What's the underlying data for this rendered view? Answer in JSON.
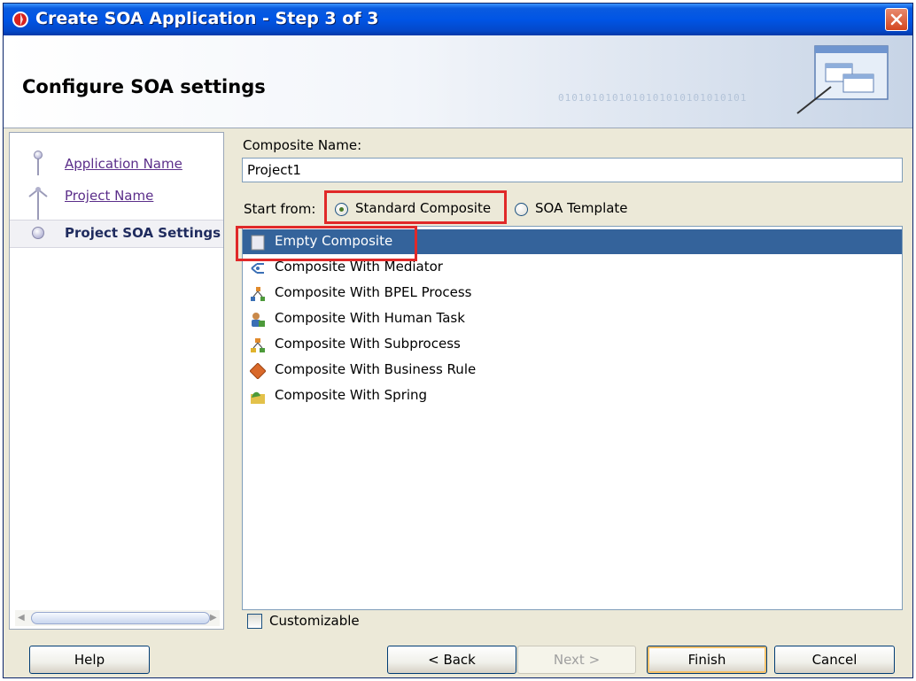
{
  "window": {
    "title": "Create SOA Application - Step 3 of 3"
  },
  "header": {
    "title": "Configure SOA settings",
    "binary_text": "0101010101010101010101010101"
  },
  "sidebar": {
    "steps": [
      {
        "label": "Application Name"
      },
      {
        "label": "Project Name"
      },
      {
        "label": "Project SOA Settings"
      }
    ]
  },
  "form": {
    "composite_name_label": "Composite Name:",
    "composite_name_value": "Project1",
    "start_from_label": "Start from:",
    "radio_standard": "Standard Composite",
    "radio_template": "SOA Template",
    "selected_radio": "Standard Composite",
    "customizable_label": "Customizable"
  },
  "templates": {
    "items": [
      {
        "label": "Empty Composite",
        "icon": "empty-composite-icon",
        "selected": true
      },
      {
        "label": "Composite With Mediator",
        "icon": "mediator-icon"
      },
      {
        "label": "Composite With BPEL Process",
        "icon": "bpel-process-icon"
      },
      {
        "label": "Composite With Human Task",
        "icon": "human-task-icon"
      },
      {
        "label": "Composite With Subprocess",
        "icon": "subprocess-icon"
      },
      {
        "label": "Composite With Business Rule",
        "icon": "business-rule-icon"
      },
      {
        "label": "Composite With Spring",
        "icon": "spring-icon"
      }
    ]
  },
  "buttons": {
    "help": "Help",
    "back": "< Back",
    "next": "Next >",
    "finish": "Finish",
    "cancel": "Cancel"
  },
  "colors": {
    "title_bar": "#0055e5",
    "selection": "#34639b",
    "highlight_box": "#e02929",
    "link": "#5b2e8a"
  }
}
